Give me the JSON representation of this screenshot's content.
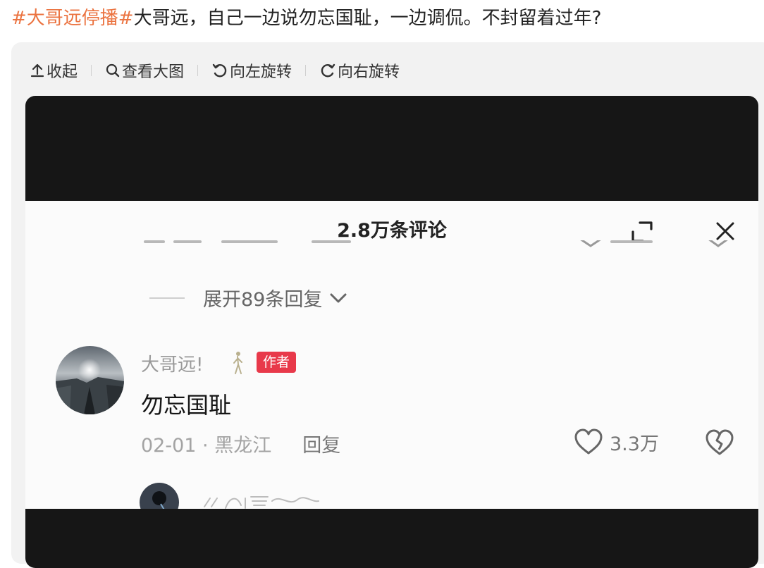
{
  "post": {
    "hashtag": "#大哥远停播#",
    "text": "大哥远，自己一边说勿忘国耻，一边调侃。不封留着过年?"
  },
  "toolbar": {
    "collapse": "收起",
    "view_large": "查看大图",
    "rotate_left": "向左旋转",
    "rotate_right": "向右旋转"
  },
  "comments_panel": {
    "title": "2.8万条评论",
    "expand_replies": "展开89条回复",
    "comment": {
      "author": "大哥远!",
      "badge": "作者",
      "text": "勿忘国耻",
      "date": "02-01",
      "location": "黑龙江",
      "date_location": "02-01 · 黑龙江",
      "reply": "回复",
      "likes": "3.3万"
    }
  },
  "colors": {
    "hashtag": "#eb7340",
    "badge": "#e8394a",
    "frame": "#161616"
  },
  "icons": {
    "collapse": "arrow-up-bar-icon",
    "view_large": "search-icon",
    "rotate_left": "rotate-left-icon",
    "rotate_right": "rotate-right-icon",
    "expand": "expand-icon",
    "close": "close-icon",
    "like": "heart-icon",
    "dislike": "broken-heart-icon"
  }
}
